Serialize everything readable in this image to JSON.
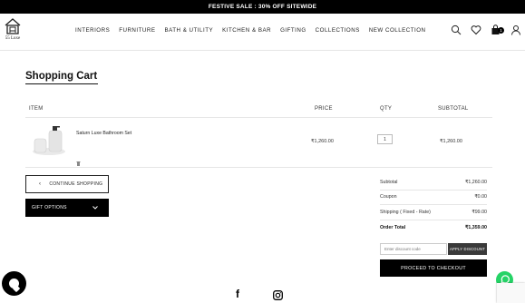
{
  "promo": {
    "text": "FESTIVE SALE : 30% OFF SITEWIDE"
  },
  "logo": {
    "text": "55 Luxe"
  },
  "nav": [
    {
      "label": "INTERIORS"
    },
    {
      "label": "FURNITURE"
    },
    {
      "label": "BATH & UTILITY"
    },
    {
      "label": "KITCHEN & BAR"
    },
    {
      "label": "GIFTING"
    },
    {
      "label": "COLLECTIONS"
    },
    {
      "label": "NEW COLLECTION"
    }
  ],
  "header_icons": [
    "search-icon",
    "heart-icon",
    "bag-icon",
    "user-icon"
  ],
  "cart": {
    "count": "1"
  },
  "page": {
    "title": "Shopping Cart"
  },
  "table": {
    "headers": {
      "item": "ITEM",
      "price": "PRICE",
      "qty": "QTY",
      "subtotal": "SUBTOTAL"
    },
    "rows": [
      {
        "name": "Saturn Luxe Bathroom Set",
        "price": "₹1,260.00",
        "qty": "1",
        "subtotal": "₹1,260.00"
      }
    ]
  },
  "buttons": {
    "continue": "CONTINUE SHOPPING",
    "gift": "GIFT OPTIONS",
    "apply": "APPLY DISCOUNT",
    "checkout": "PROCEED TO CHECKOUT"
  },
  "discount": {
    "placeholder": "Enter discount code"
  },
  "totals": {
    "subtotal_label": "Subtotal",
    "subtotal_value": "₹1,260.00",
    "coupon_label": "Coupon",
    "coupon_value": "₹0.00",
    "shipping_label": "Shipping ( Fixed - Rate)",
    "shipping_value": "₹99.00",
    "order_label": "Order Total",
    "order_value": "₹1,359.00"
  },
  "colors": {
    "accent": "#000000",
    "whatsapp": "#25d366",
    "apply_button": "#3a3a3a"
  }
}
